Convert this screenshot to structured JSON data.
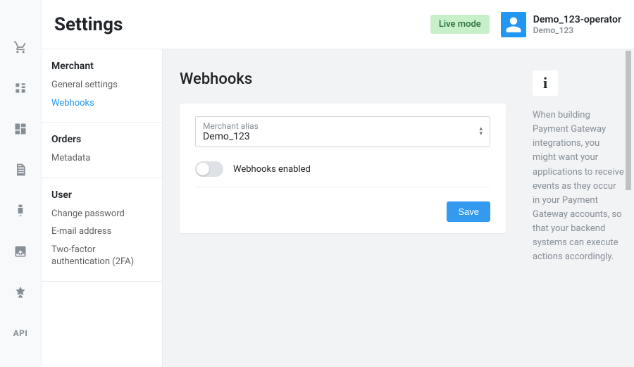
{
  "header": {
    "title": "Settings",
    "live_badge": "Live mode",
    "user_name": "Demo_123-operator",
    "user_sub": "Demo_123"
  },
  "sidenav": {
    "merchant": {
      "heading": "Merchant",
      "general": "General settings",
      "webhooks": "Webhooks"
    },
    "orders": {
      "heading": "Orders",
      "metadata": "Metadata"
    },
    "user": {
      "heading": "User",
      "change_password": "Change password",
      "email": "E-mail address",
      "tfa": "Two-factor authentication (2FA)"
    }
  },
  "page": {
    "title": "Webhooks",
    "alias_label": "Merchant alias",
    "alias_value": "Demo_123",
    "webhooks_toggle_label": "Webhooks enabled",
    "webhooks_enabled": false,
    "save_label": "Save"
  },
  "info": {
    "text": "When building Payment Gateway integrations, you might want your applications to receive events as they occur in your Payment Gateway accounts, so that your backend systems can execute actions accordingly."
  }
}
